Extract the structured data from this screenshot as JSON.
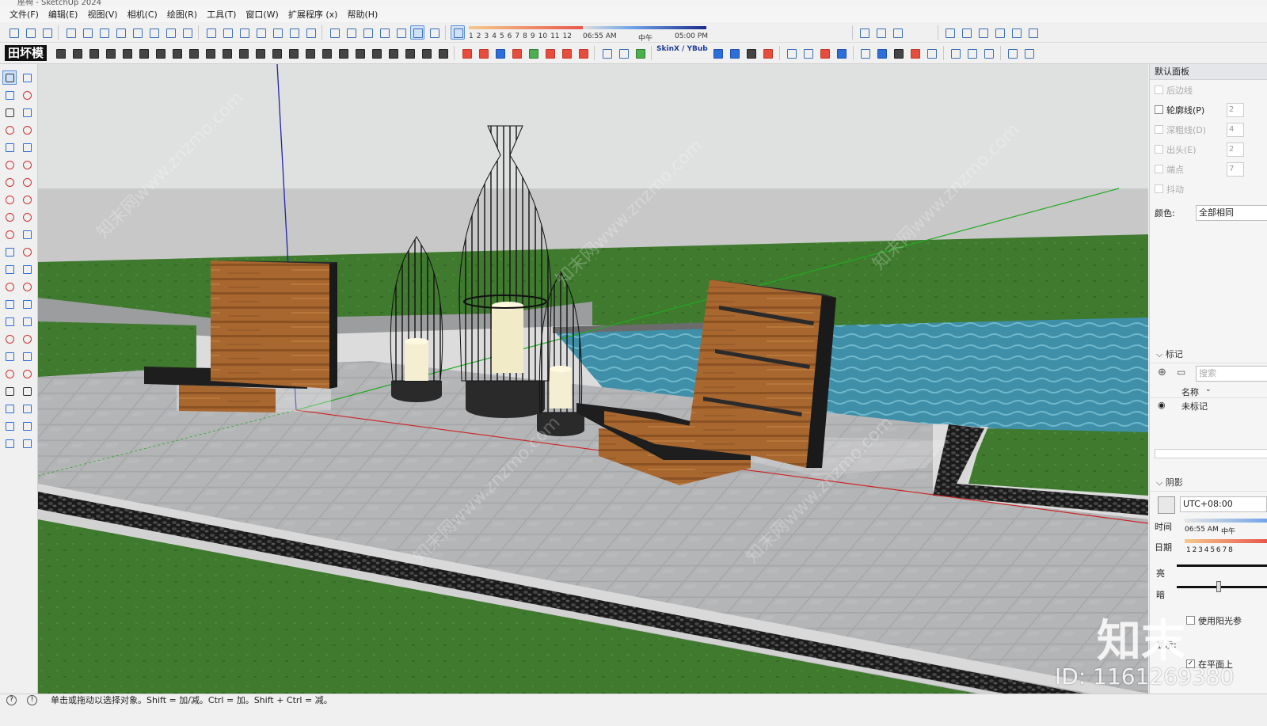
{
  "window": {
    "title": "座椅 - SketchUp 2024"
  },
  "menu": [
    "文件(F)",
    "编辑(E)",
    "视图(V)",
    "相机(C)",
    "绘图(R)",
    "工具(T)",
    "窗口(W)",
    "扩展程序 (x)",
    "帮助(H)"
  ],
  "toolbar": {
    "months": [
      "1",
      "2",
      "3",
      "4",
      "5",
      "6",
      "7",
      "8",
      "9",
      "10",
      "11",
      "12"
    ],
    "time_start": "06:55 AM",
    "time_mid": "中午",
    "time_end": "05:00 PM",
    "logo_text": "田坏模",
    "skinx_label": "SkinX / YBub"
  },
  "right_panel": {
    "title": "默认面板",
    "edge_options": [
      {
        "label": "后边线",
        "checked": false,
        "enabled": false,
        "value": ""
      },
      {
        "label": "轮廓线(P)",
        "checked": false,
        "enabled": true,
        "value": "2"
      },
      {
        "label": "深粗线(D)",
        "checked": false,
        "enabled": false,
        "value": "4"
      },
      {
        "label": "出头(E)",
        "checked": false,
        "enabled": false,
        "value": "2"
      },
      {
        "label": "端点",
        "checked": false,
        "enabled": false,
        "value": "7"
      },
      {
        "label": "抖动",
        "checked": false,
        "enabled": false,
        "value": ""
      }
    ],
    "color_label": "颜色:",
    "color_value": "全部相同",
    "tags": {
      "title": "标记",
      "search_placeholder": "搜索",
      "column_name": "名称",
      "items": [
        "未标记"
      ]
    },
    "shadows": {
      "title": "阴影",
      "timezone": "UTC+08:00",
      "time_label": "时间",
      "time_value": "06:55 AM",
      "time_noon": "中午",
      "date_label": "日期",
      "date_digits": "1 2 3 4 5 6 7 8",
      "light_label": "亮",
      "dark_label": "暗",
      "use_sun_label": "使用阳光参",
      "display_label": "显示:",
      "on_faces_label": "在平面上",
      "on_faces_checked": true
    }
  },
  "status": {
    "message": "单击或拖动以选择对象。Shift = 加/减。Ctrl = 加。Shift + Ctrl = 减。"
  },
  "watermark": {
    "brand": "知末",
    "id_text": "ID: 1161269380",
    "site": "知末网www.znzmo.com"
  }
}
